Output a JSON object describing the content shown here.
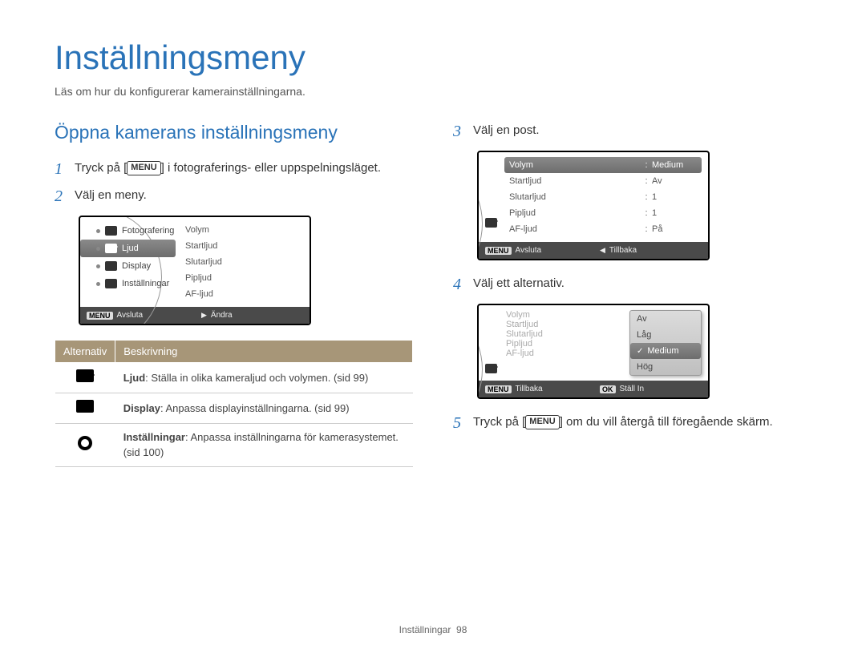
{
  "main_title": "Inställningsmeny",
  "subtitle": "Läs om hur du konfigurerar kamerainställningarna.",
  "left": {
    "section_title": "Öppna kamerans inställningsmeny",
    "step1_num": "1",
    "step1_pre": "Tryck på [",
    "step1_btn": "MENU",
    "step1_post": "] i fotograferings- eller uppspelningsläget.",
    "step2_num": "2",
    "step2_text": "Välj en meny.",
    "cam2": {
      "menu": [
        "Fotografering",
        "Ljud",
        "Display",
        "Inställningar"
      ],
      "menu_selected": 1,
      "right": [
        "Volym",
        "Startljud",
        "Slutarljud",
        "Pipljud",
        "AF-ljud"
      ],
      "foot_left_btn": "MENU",
      "foot_left": "Avsluta",
      "foot_right_icon": "▶",
      "foot_right": "Ändra"
    },
    "table": {
      "head_alt": "Alternativ",
      "head_desc": "Beskrivning",
      "rows": [
        {
          "icon": "speaker",
          "bold": "Ljud",
          "text": ": Ställa in olika kameraljud och volymen. (sid 99)"
        },
        {
          "icon": "display",
          "bold": "Display",
          "text": ": Anpassa displayinställningarna. (sid 99)"
        },
        {
          "icon": "gear",
          "bold": "Inställningar",
          "text": ": Anpassa inställningarna för kamerasystemet. (sid 100)"
        }
      ]
    }
  },
  "right": {
    "step3_num": "3",
    "step3_text": "Välj en post.",
    "cam3": {
      "rows": [
        {
          "k": "Volym",
          "v": "Medium",
          "sel": true
        },
        {
          "k": "Startljud",
          "v": "Av"
        },
        {
          "k": "Slutarljud",
          "v": "1"
        },
        {
          "k": "Pipljud",
          "v": "1"
        },
        {
          "k": "AF-ljud",
          "v": "På"
        }
      ],
      "foot_left_btn": "MENU",
      "foot_left": "Avsluta",
      "foot_right_icon": "◀",
      "foot_right": "Tillbaka"
    },
    "step4_num": "4",
    "step4_text": "Välj ett alternativ.",
    "cam4": {
      "left": [
        "Volym",
        "Startljud",
        "Slutarljud",
        "Pipljud",
        "AF-ljud"
      ],
      "opts": [
        "Av",
        "Låg",
        "Medium",
        "Hög"
      ],
      "opt_selected": 2,
      "foot_left_btn": "MENU",
      "foot_left": "Tillbaka",
      "foot_right_btn": "OK",
      "foot_right": "Ställ In"
    },
    "step5_num": "5",
    "step5_pre": "Tryck på [",
    "step5_btn": "MENU",
    "step5_post": "] om du vill återgå till föregående skärm."
  },
  "footer_section": "Inställningar",
  "footer_page": "98"
}
